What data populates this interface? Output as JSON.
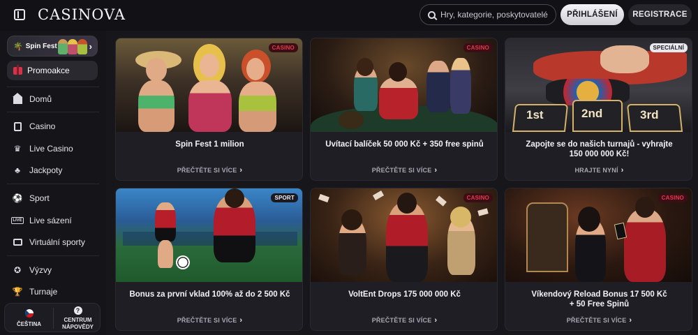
{
  "header": {
    "logo": "CASINOVA",
    "search_placeholder": "Hry, kategorie, poskytovatelé",
    "login_label": "PŘIHLÁŠENÍ",
    "register_label": "REGISTRACE"
  },
  "sidebar": {
    "banner_label": "Spin Fest",
    "promo_label": "Promoakce",
    "items": [
      {
        "label": "Domů",
        "icon": "home-icon"
      },
      {
        "label": "Casino",
        "icon": "slot-icon"
      },
      {
        "label": "Live Casino",
        "icon": "live-casino-icon"
      },
      {
        "label": "Jackpoty",
        "icon": "clover-icon"
      },
      {
        "label": "Sport",
        "icon": "football-icon"
      },
      {
        "label": "Live sázení",
        "icon": "live-icon"
      },
      {
        "label": "Virtuální sporty",
        "icon": "monitor-icon"
      },
      {
        "label": "Výzvy",
        "icon": "medal-icon"
      },
      {
        "label": "Turnaje",
        "icon": "trophy-icon"
      }
    ],
    "language_label": "ČEŠTINA",
    "help_label_1": "CENTRUM",
    "help_label_2": "NÁPOVĚDY"
  },
  "cards": [
    {
      "tag": "CASINO",
      "title": "Spin Fest 1 milion",
      "more": "PŘEČTĚTE SI VÍCE"
    },
    {
      "tag": "CASINO",
      "title": "Uvítací balíček 50 000 Kč + 350 free spinů",
      "more": "PŘEČTĚTE SI VÍCE"
    },
    {
      "tag": "SPECIÁLNÍ",
      "title_line1": "Zapojte se do našich turnajů - vyhrajte",
      "title_line2": "150 000 000 Kč!",
      "more": "HRAJTE NYNÍ"
    },
    {
      "tag": "SPORT",
      "title": "Bonus za první vklad 100% až do 2 500 Kč",
      "more": "PŘEČTĚTE SI VÍCE"
    },
    {
      "tag": "CASINO",
      "title": "VoltEnt Drops 175 000 000 Kč",
      "more": "PŘEČTĚTE SI VÍCE"
    },
    {
      "tag": "CASINO",
      "title_line1": "Víkendový Reload Bonus 17 500 Kč",
      "title_line2": "+ 50 Free Spinů",
      "more": "PŘEČTĚTE SI VÍCE"
    }
  ],
  "scene_text": {
    "podium_1": "1st",
    "podium_2": "2nd",
    "podium_3": "3rd"
  },
  "colors": {
    "background": "#17161b",
    "card": "#1f1e24",
    "accent_red": "#e33a4e",
    "button_light": "#ececf1"
  }
}
